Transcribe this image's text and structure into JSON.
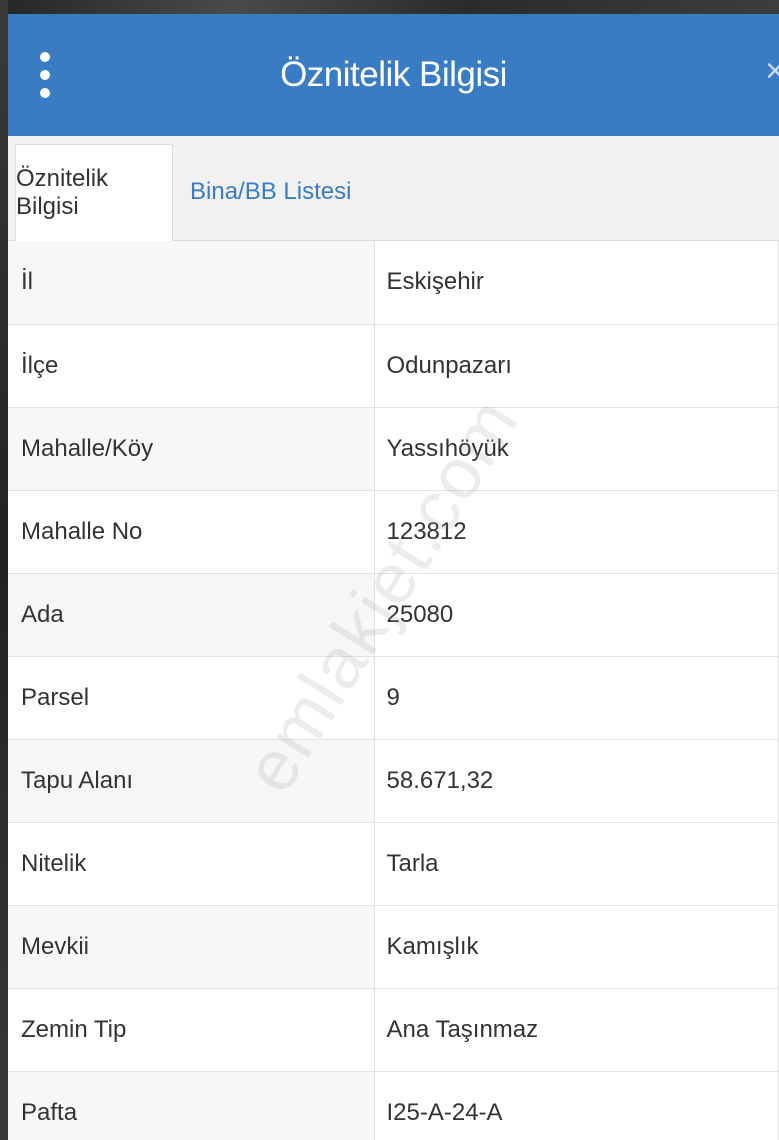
{
  "header": {
    "title": "Öznitelik Bilgisi",
    "close_label": "×"
  },
  "tabs": [
    {
      "label": "Öznitelik Bilgisi",
      "active": true
    },
    {
      "label": "Bina/BB Listesi",
      "active": false
    }
  ],
  "attributes": [
    {
      "key": "İl",
      "value": "Eskişehir"
    },
    {
      "key": "İlçe",
      "value": "Odunpazarı"
    },
    {
      "key": "Mahalle/Köy",
      "value": "Yassıhöyük"
    },
    {
      "key": "Mahalle No",
      "value": "123812"
    },
    {
      "key": "Ada",
      "value": "25080"
    },
    {
      "key": "Parsel",
      "value": "9"
    },
    {
      "key": "Tapu Alanı",
      "value": "58.671,32"
    },
    {
      "key": "Nitelik",
      "value": "Tarla"
    },
    {
      "key": "Mevkii",
      "value": "Kamışlık"
    },
    {
      "key": "Zemin Tip",
      "value": "Ana Taşınmaz"
    },
    {
      "key": "Pafta",
      "value": "I25-A-24-A"
    }
  ],
  "watermark": "emlakjet.com",
  "colors": {
    "header_bg": "#3a7cc4",
    "tab_link": "#3a7cc4",
    "text": "#333333"
  },
  "icons": {
    "menu": "vertical-dots-icon",
    "close": "close-icon"
  }
}
